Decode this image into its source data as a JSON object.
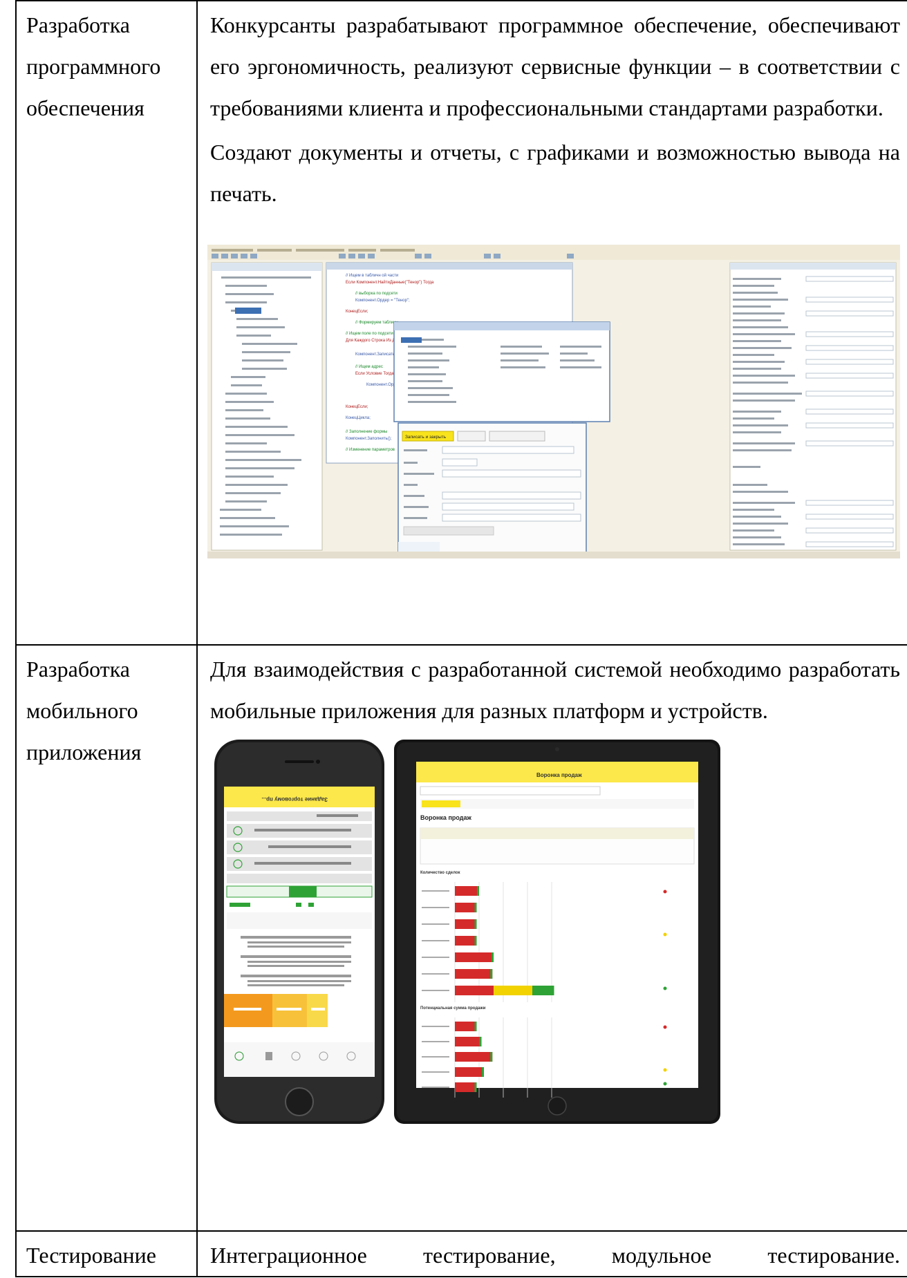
{
  "rows": [
    {
      "label": [
        "Разработка",
        "программного",
        "обеспечения"
      ],
      "paragraphs": [
        "Конкурсанты разрабатывают программное обеспечение, обеспечивают его эргономичность, реализуют сервисные функции – в соответствии с требованиями клиента и профессиональными стандартами разработки.",
        "Создают документы и отчеты, с графиками и возможностью вывода на печать."
      ]
    },
    {
      "label": [
        "Разработка",
        "мобильного",
        "приложения"
      ],
      "paragraphs": [
        "Для взаимодействия с разработанной системой необходимо разработать мобильные приложения для разных платформ и устройств."
      ]
    },
    {
      "label": [
        "Тестирование"
      ],
      "paragraphs": [
        "Интеграционное тестирование, модульное тестирование."
      ]
    }
  ],
  "figure1": {
    "desc_alt": "Конфигуратор",
    "form_button": "Записать и закрыть",
    "editor_lines": [
      "// Ищем в табличн ой части",
      "Если Компонент.НайтиДанные(\"Тенор\") Тогда",
      "// выборка по подсети",
      "Компонент.Ордер = \"Тенор\";",
      "КонецЕсли;",
      "Для Каждого Строка Из Данные Цикл",
      "Компонент.Записать();",
      "КонецЦикла;"
    ]
  },
  "figure2": {
    "phone_header": "Задание торговому пр...",
    "tablet_title": "Воронка продаж",
    "tablet_heading": "Воронка продаж",
    "tablet_chart1_title": "Количество сделок",
    "tablet_chart2_title": "Потенциальная сумма продажи",
    "tablet_chart1_bars": [
      [
        1,
        0,
        0
      ],
      [
        0.9,
        0,
        0
      ],
      [
        0.9,
        0,
        0
      ],
      [
        0.9,
        0,
        0
      ],
      [
        1.6,
        0,
        0
      ],
      [
        1.55,
        0,
        0
      ],
      [
        1.6,
        1.6,
        0.9
      ]
    ],
    "tablet_chart2_bars": [
      [
        0.9,
        0,
        0
      ],
      [
        1.1,
        0,
        0
      ],
      [
        1.55,
        0,
        0
      ],
      [
        1.2,
        0,
        0
      ],
      [
        0.9,
        0,
        0
      ]
    ],
    "colors": {
      "green_bar": "#2fa236",
      "red_bar": "#d52a2a",
      "yellow_bar": "#f2d200",
      "orange": "#f39a1e",
      "app_yellow": "#fce84a"
    }
  }
}
